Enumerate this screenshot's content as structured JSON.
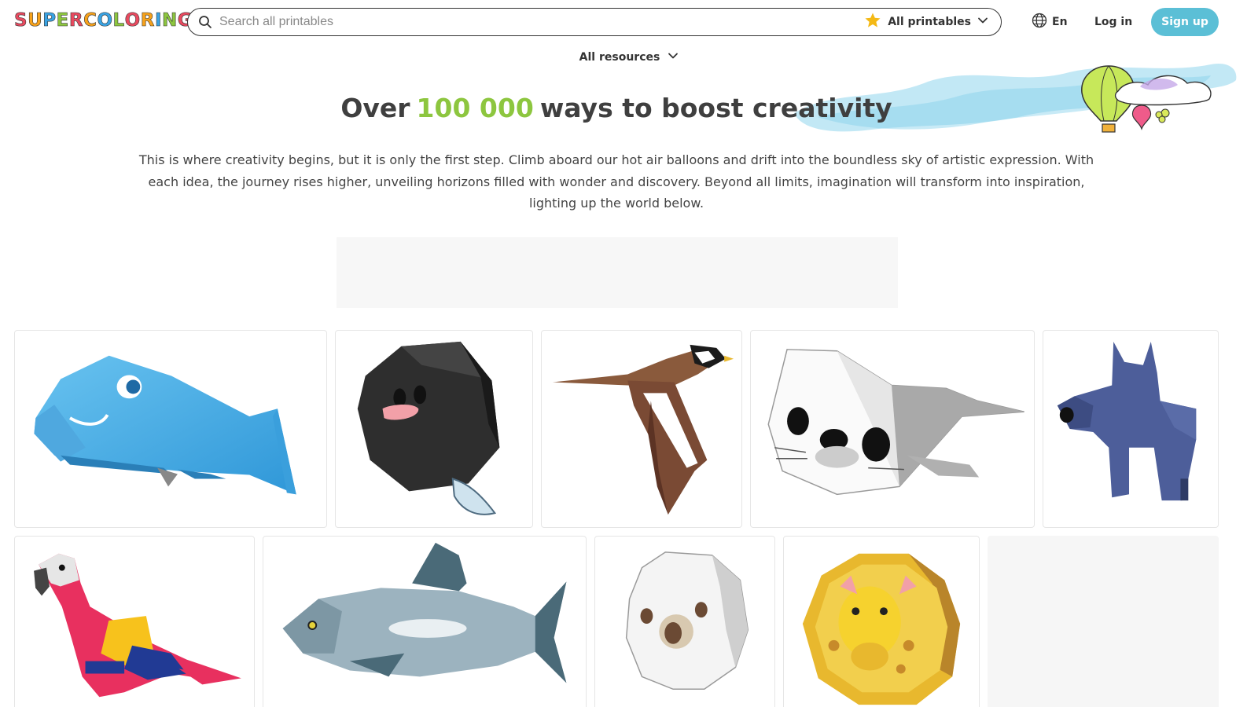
{
  "header": {
    "logo_letters": [
      "S",
      "U",
      "P",
      "E",
      "R",
      "C",
      "O",
      "L",
      "O",
      "R",
      "I",
      "N",
      "G"
    ],
    "logo_colors": [
      "#e84a5f",
      "#f7a21b",
      "#3aa3e3",
      "#8dc63f",
      "#e84a5f",
      "#f7a21b",
      "#3aa3e3",
      "#8dc63f",
      "#e84a5f",
      "#f7a21b",
      "#3aa3e3",
      "#8dc63f",
      "#e84a5f"
    ],
    "search_placeholder": "Search all printables",
    "filter_label": "All printables",
    "language": "En",
    "login_label": "Log in",
    "signup_label": "Sign up"
  },
  "resources_label": "All resources",
  "hero": {
    "headline_pre": "Over",
    "headline_number": "100 000",
    "headline_post": "ways to boost creativity",
    "intro": "This is where creativity begins, but it is only the first step. Climb aboard our hot air balloons and drift into the boundless sky of artistic expression. With each idea, the journey rises higher, unveiling horizons filled with wonder and discovery. Beyond all limits, imagination will transform into inspiration, lighting up the world below."
  },
  "colors": {
    "accent_green": "#8dc63f",
    "signup_blue": "#5bbfd6",
    "text_dark": "#3f3f3f"
  },
  "grid": {
    "row1": [
      "blue-whale-papercraft",
      "black-fish-papercraft",
      "bird-papercraft",
      "seal-papercraft",
      "scottish-terrier-papercraft"
    ],
    "row2": [
      "macaw-papercraft",
      "salmon-papercraft",
      "octopus-papercraft",
      "giraffe-coin-papercraft",
      "placeholder"
    ]
  }
}
